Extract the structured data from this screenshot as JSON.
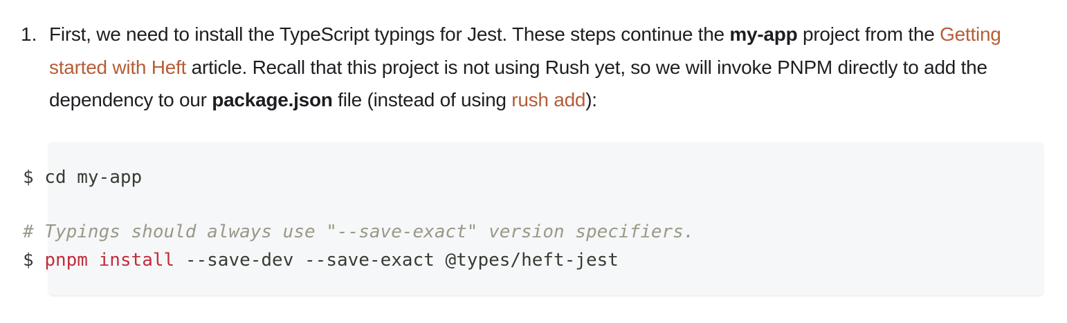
{
  "list": {
    "number": "1.",
    "seg1": "First, we need to install the TypeScript typings for Jest. These steps continue the ",
    "bold1": "my-app",
    "seg2": " project from the ",
    "link1": "Getting started with Heft",
    "seg3": " article. Recall that this project is not using Rush yet, so we will invoke PNPM directly to add the dependency to our ",
    "bold2": "package.json",
    "seg4": " file (instead of using ",
    "link2": "rush add",
    "seg5": "):"
  },
  "code": {
    "line1": "$ cd my-app",
    "comment": "# Typings should always use \"--save-exact\" version specifiers.",
    "prompt": "$ ",
    "cmd_pnpm": "pnpm",
    "space": " ",
    "cmd_install": "install",
    "args": " --save-dev --save-exact @types/heft-jest"
  },
  "colors": {
    "link": "#b65c36",
    "code_background": "#f6f7f8",
    "comment": "#999988",
    "command": "#c12c3d"
  }
}
